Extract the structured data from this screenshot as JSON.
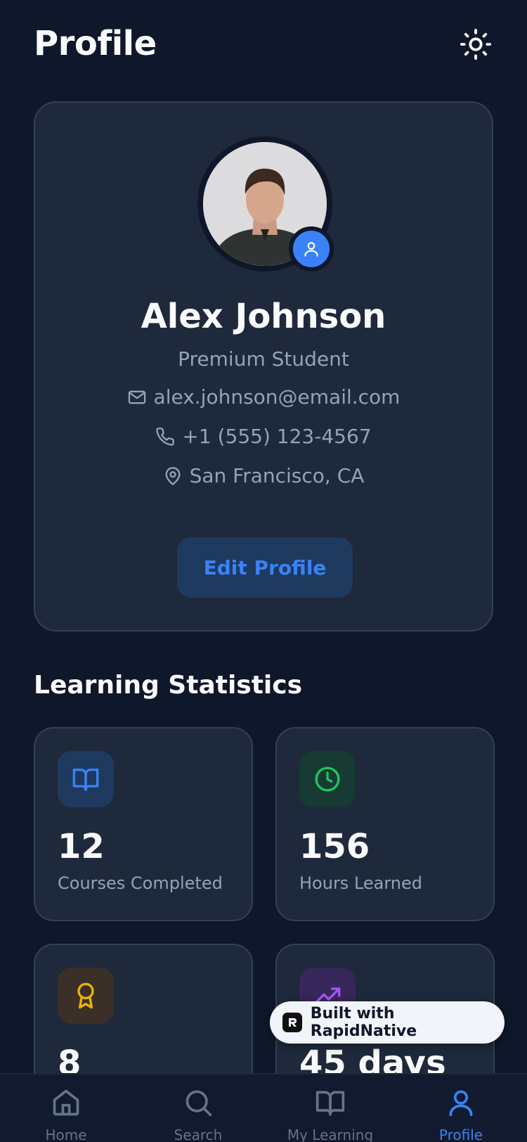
{
  "header": {
    "title": "Profile",
    "theme_icon": "sun-icon"
  },
  "profile": {
    "name": "Alex Johnson",
    "role": "Premium Student",
    "email": "alex.johnson@email.com",
    "phone": "+1 (555) 123-4567",
    "location": "San Francisco, CA",
    "edit_label": "Edit Profile"
  },
  "stats": {
    "title": "Learning Statistics",
    "items": [
      {
        "value": "12",
        "label": "Courses Completed",
        "icon": "book-open-icon",
        "color": "#3b82f6"
      },
      {
        "value": "156",
        "label": "Hours Learned",
        "icon": "clock-icon",
        "color": "#22c55e"
      },
      {
        "value": "8",
        "label": "",
        "icon": "award-icon",
        "color": "#eab308"
      },
      {
        "value": "45 days",
        "label": "",
        "icon": "trending-up-icon",
        "color": "#a855f7"
      }
    ]
  },
  "badge": {
    "text": "Built with RapidNative"
  },
  "nav": {
    "items": [
      {
        "label": "Home",
        "icon": "home-icon",
        "active": false
      },
      {
        "label": "Search",
        "icon": "search-icon",
        "active": false
      },
      {
        "label": "My Learning",
        "icon": "book-open-icon",
        "active": false
      },
      {
        "label": "Profile",
        "icon": "user-icon",
        "active": true
      }
    ]
  },
  "colors": {
    "background": "#0f172a",
    "card": "#1e293b",
    "accent": "#3b82f6"
  }
}
